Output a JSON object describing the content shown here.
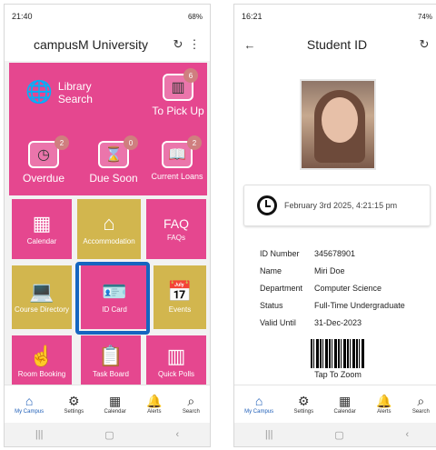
{
  "left": {
    "status": {
      "time": "21:40",
      "battery": "68%"
    },
    "title": "campusM University",
    "tiles": [
      {
        "label": "Library Search"
      },
      {
        "label": "To Pick Up",
        "badge": "6"
      },
      {
        "label": "Overdue",
        "badge": "2"
      },
      {
        "label": "Due Soon",
        "badge": "0"
      },
      {
        "label": "Current Loans",
        "badge": "2"
      },
      {
        "label": "Calendar"
      },
      {
        "label": "Accommodation"
      },
      {
        "label": "FAQs"
      },
      {
        "label": "Course Directory"
      },
      {
        "label": "ID Card"
      },
      {
        "label": "Events"
      },
      {
        "label": "Room Booking"
      },
      {
        "label": "Task Board"
      },
      {
        "label": "Quick Polls"
      }
    ],
    "nav": [
      "My Campus",
      "Settings",
      "Calendar",
      "Alerts",
      "Search"
    ]
  },
  "right": {
    "status": {
      "time": "16:21",
      "battery": "74%"
    },
    "title": "Student ID",
    "date": "February 3rd 2025, 4:21:15 pm",
    "details": [
      {
        "k": "ID Number",
        "v": "345678901"
      },
      {
        "k": "Name",
        "v": "Miri Doe"
      },
      {
        "k": "Department",
        "v": "Computer Science"
      },
      {
        "k": "Status",
        "v": "Full-Time Undergraduate"
      },
      {
        "k": "Valid Until",
        "v": "31-Dec-2023"
      }
    ],
    "tap_label": "Tap To Zoom",
    "nav": [
      "My Campus",
      "Settings",
      "Calendar",
      "Alerts",
      "Search"
    ]
  }
}
